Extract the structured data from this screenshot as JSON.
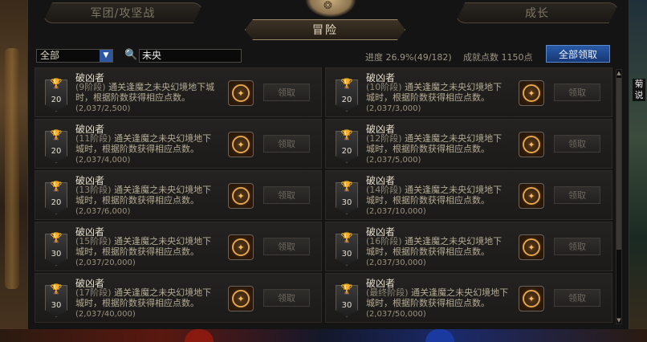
{
  "tabs": {
    "left_label": "军团/攻坚战",
    "right_label": "成长",
    "active_label": "冒险"
  },
  "filter": {
    "category_selected": "全部",
    "search_value": "未央"
  },
  "stats": {
    "progress_text": "进度 26.9%(49/182)",
    "points_text": "成就点数 1150点"
  },
  "buttons": {
    "claim_all": "全部领取",
    "claim": "领取"
  },
  "side_hint": "菊\n说",
  "icons": {
    "trophy": "trophy-icon",
    "reward": "reward-emblem-icon",
    "search": "search-icon"
  },
  "achievements": [
    {
      "title": "破凶者",
      "stage": "(9阶段)",
      "desc": "通关逢魔之未央幻境地下城时，根据阶数获得相应点数。",
      "progress": "(2,037/2,500)",
      "points": "20"
    },
    {
      "title": "破凶者",
      "stage": "(10阶段)",
      "desc": "通关逢魔之未央幻境地下城时，根据阶数获得相应点数。",
      "progress": "(2,037/3,000)",
      "points": "20"
    },
    {
      "title": "破凶者",
      "stage": "(11阶段)",
      "desc": "通关逢魔之未央幻境地下城时，根据阶数获得相应点数。",
      "progress": "(2,037/4,000)",
      "points": "20"
    },
    {
      "title": "破凶者",
      "stage": "(12阶段)",
      "desc": "通关逢魔之未央幻境地下城时，根据阶数获得相应点数。",
      "progress": "(2,037/5,000)",
      "points": "20"
    },
    {
      "title": "破凶者",
      "stage": "(13阶段)",
      "desc": "通关逢魔之未央幻境地下城时，根据阶数获得相应点数。",
      "progress": "(2,037/6,000)",
      "points": "20"
    },
    {
      "title": "破凶者",
      "stage": "(14阶段)",
      "desc": "通关逢魔之未央幻境地下城时，根据阶数获得相应点数。",
      "progress": "(2,037/10,000)",
      "points": "30"
    },
    {
      "title": "破凶者",
      "stage": "(15阶段)",
      "desc": "通关逢魔之未央幻境地下城时，根据阶数获得相应点数。",
      "progress": "(2,037/20,000)",
      "points": "30"
    },
    {
      "title": "破凶者",
      "stage": "(16阶段)",
      "desc": "通关逢魔之未央幻境地下城时，根据阶数获得相应点数。",
      "progress": "(2,037/30,000)",
      "points": "30"
    },
    {
      "title": "破凶者",
      "stage": "(17阶段)",
      "desc": "通关逢魔之未央幻境地下城时，根据阶数获得相应点数。",
      "progress": "(2,037/40,000)",
      "points": "30"
    },
    {
      "title": "破凶者",
      "stage": "(最终阶段)",
      "desc": "通关逢魔之未央幻境地下城时，根据阶数获得相应点数。",
      "progress": "(2,037/50,000)",
      "points": "30"
    }
  ]
}
